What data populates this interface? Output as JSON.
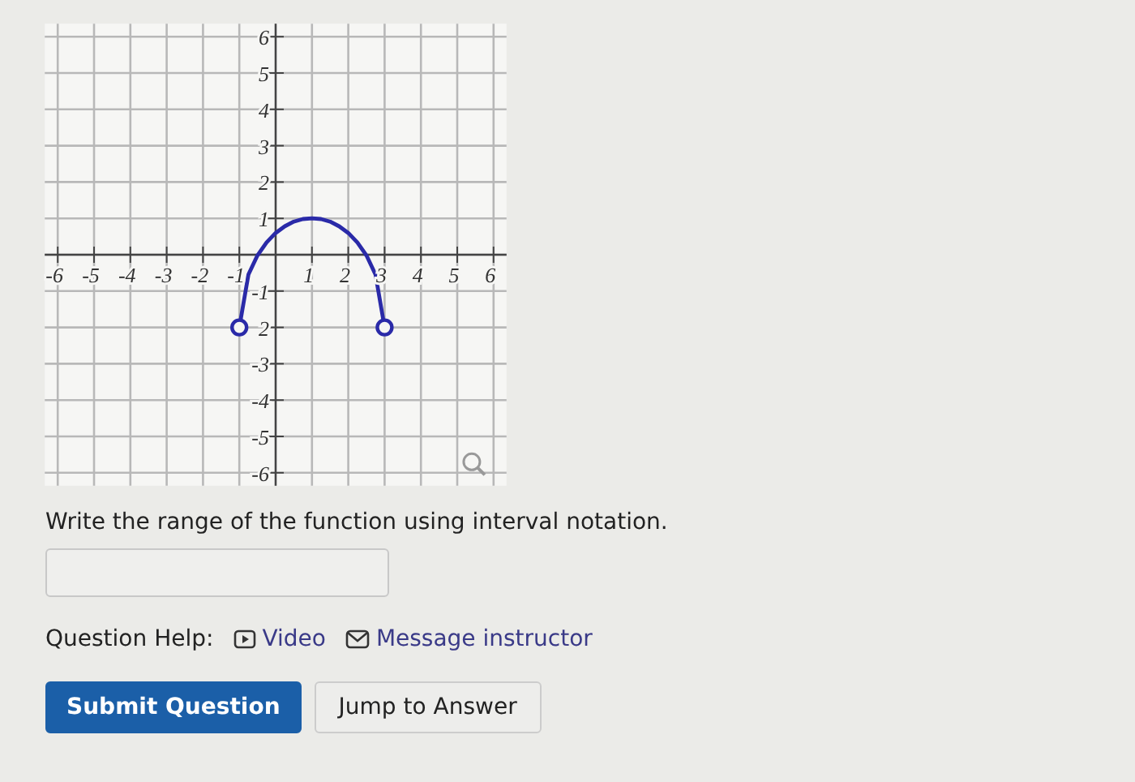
{
  "graph": {
    "chart_data": {
      "type": "line",
      "xlim": [
        -6,
        6
      ],
      "ylim": [
        -6,
        6
      ],
      "xticks": [
        {
          "value": -6,
          "label": "-6"
        },
        {
          "value": -5,
          "label": "-5"
        },
        {
          "value": -4,
          "label": "-4"
        },
        {
          "value": -3,
          "label": "-3"
        },
        {
          "value": -2,
          "label": "-2"
        },
        {
          "value": -1,
          "label": "-1"
        },
        {
          "value": 1,
          "label": "1"
        },
        {
          "value": 2,
          "label": "2"
        },
        {
          "value": 3,
          "label": "3"
        },
        {
          "value": 4,
          "label": "4"
        },
        {
          "value": 5,
          "label": "5"
        },
        {
          "value": 6,
          "label": "6"
        }
      ],
      "yticks": [
        {
          "value": 6,
          "label": "6"
        },
        {
          "value": 5,
          "label": "5"
        },
        {
          "value": 4,
          "label": "4"
        },
        {
          "value": 3,
          "label": "3"
        },
        {
          "value": 2,
          "label": "2"
        },
        {
          "value": 1,
          "label": "1"
        },
        {
          "value": -1,
          "label": "-1"
        },
        {
          "value": -2,
          "label": "2"
        },
        {
          "value": -3,
          "label": "-3"
        },
        {
          "value": -4,
          "label": "-4"
        },
        {
          "value": -5,
          "label": "-5"
        },
        {
          "value": -6,
          "label": "-6"
        }
      ],
      "x": [
        -1,
        -0.75,
        -0.5,
        -0.25,
        0,
        0.25,
        0.5,
        0.75,
        1,
        1.25,
        1.5,
        1.75,
        2,
        2.25,
        2.5,
        2.75,
        3
      ],
      "series": [
        {
          "color": "#2a2aa8",
          "values": [
            -2,
            -0.55,
            -0.02,
            0.34,
            0.6,
            0.78,
            0.91,
            0.98,
            1,
            0.98,
            0.91,
            0.78,
            0.6,
            0.34,
            -0.02,
            -0.55,
            -2
          ]
        }
      ],
      "grid": true
    }
  },
  "question": {
    "prompt": "Write the range of the function using interval notation."
  },
  "help": {
    "label": "Question Help:",
    "links": [
      {
        "kind": "video",
        "label": "Video"
      },
      {
        "kind": "message",
        "label": "Message instructor"
      }
    ]
  },
  "buttons": [
    {
      "kind": "primary",
      "label": "Submit Question"
    },
    {
      "kind": "secondary",
      "label": "Jump to Answer"
    }
  ]
}
